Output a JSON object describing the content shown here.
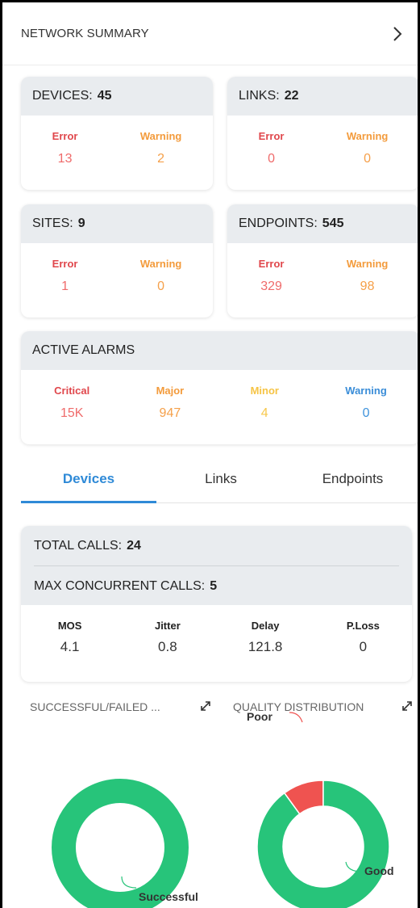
{
  "header": {
    "title": "NETWORK SUMMARY",
    "chevron_icon": "chevron-right-icon"
  },
  "devices": {
    "label": "DEVICES:",
    "count": "45",
    "error_label": "Error",
    "error_value": "13",
    "warning_label": "Warning",
    "warning_value": "2"
  },
  "links": {
    "label": "LINKS:",
    "count": "22",
    "error_label": "Error",
    "error_value": "0",
    "warning_label": "Warning",
    "warning_value": "0"
  },
  "sites": {
    "label": "SITES:",
    "count": "9",
    "error_label": "Error",
    "error_value": "1",
    "warning_label": "Warning",
    "warning_value": "0"
  },
  "endpoints": {
    "label": "ENDPOINTS:",
    "count": "545",
    "error_label": "Error",
    "error_value": "329",
    "warning_label": "Warning",
    "warning_value": "98"
  },
  "alarms": {
    "title": "ACTIVE ALARMS",
    "items": [
      {
        "label": "Critical",
        "value": "15K"
      },
      {
        "label": "Major",
        "value": "947"
      },
      {
        "label": "Minor",
        "value": "4"
      },
      {
        "label": "Warning",
        "value": "0"
      }
    ]
  },
  "tabs": [
    {
      "label": "Devices",
      "active": true
    },
    {
      "label": "Links",
      "active": false
    },
    {
      "label": "Endpoints",
      "active": false
    }
  ],
  "calls": {
    "total_label": "TOTAL CALLS:",
    "total_value": "24",
    "max_label": "MAX CONCURRENT CALLS:",
    "max_value": "5",
    "metrics": [
      {
        "label": "MOS",
        "value": "4.1"
      },
      {
        "label": "Jitter",
        "value": "0.8"
      },
      {
        "label": "Delay",
        "value": "121.8"
      },
      {
        "label": "P.Loss",
        "value": "0"
      }
    ]
  },
  "panels": {
    "left_title": "SUCCESSFUL/FAILED ...",
    "right_title": "QUALITY DISTRIBUTION",
    "expand_icon": "expand-icon"
  },
  "chart_data": [
    {
      "type": "pie",
      "title": "SUCCESSFUL/FAILED ...",
      "categories": [
        "Successful"
      ],
      "values": [
        1
      ],
      "colors": [
        "#27c47a"
      ]
    },
    {
      "type": "pie",
      "title": "QUALITY DISTRIBUTION",
      "categories": [
        "Good",
        "Poor"
      ],
      "values": [
        0.9,
        0.1
      ],
      "colors": [
        "#27c47a",
        "#ef5350"
      ]
    }
  ]
}
